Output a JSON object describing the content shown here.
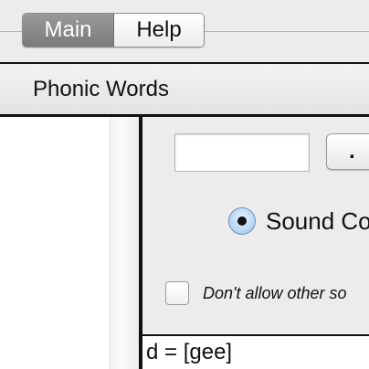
{
  "tabs": [
    {
      "label": "Main",
      "selected": true
    },
    {
      "label": "Help",
      "selected": false
    }
  ],
  "header": {
    "title": "Phonic Words"
  },
  "controls": {
    "text_input_value": "",
    "dot_button_label": ".",
    "radio_label": "Sound Co",
    "radio_selected": true,
    "checkbox_label": "Don't allow other so",
    "checkbox_checked": false
  },
  "output": {
    "line": "d = [gee]"
  }
}
